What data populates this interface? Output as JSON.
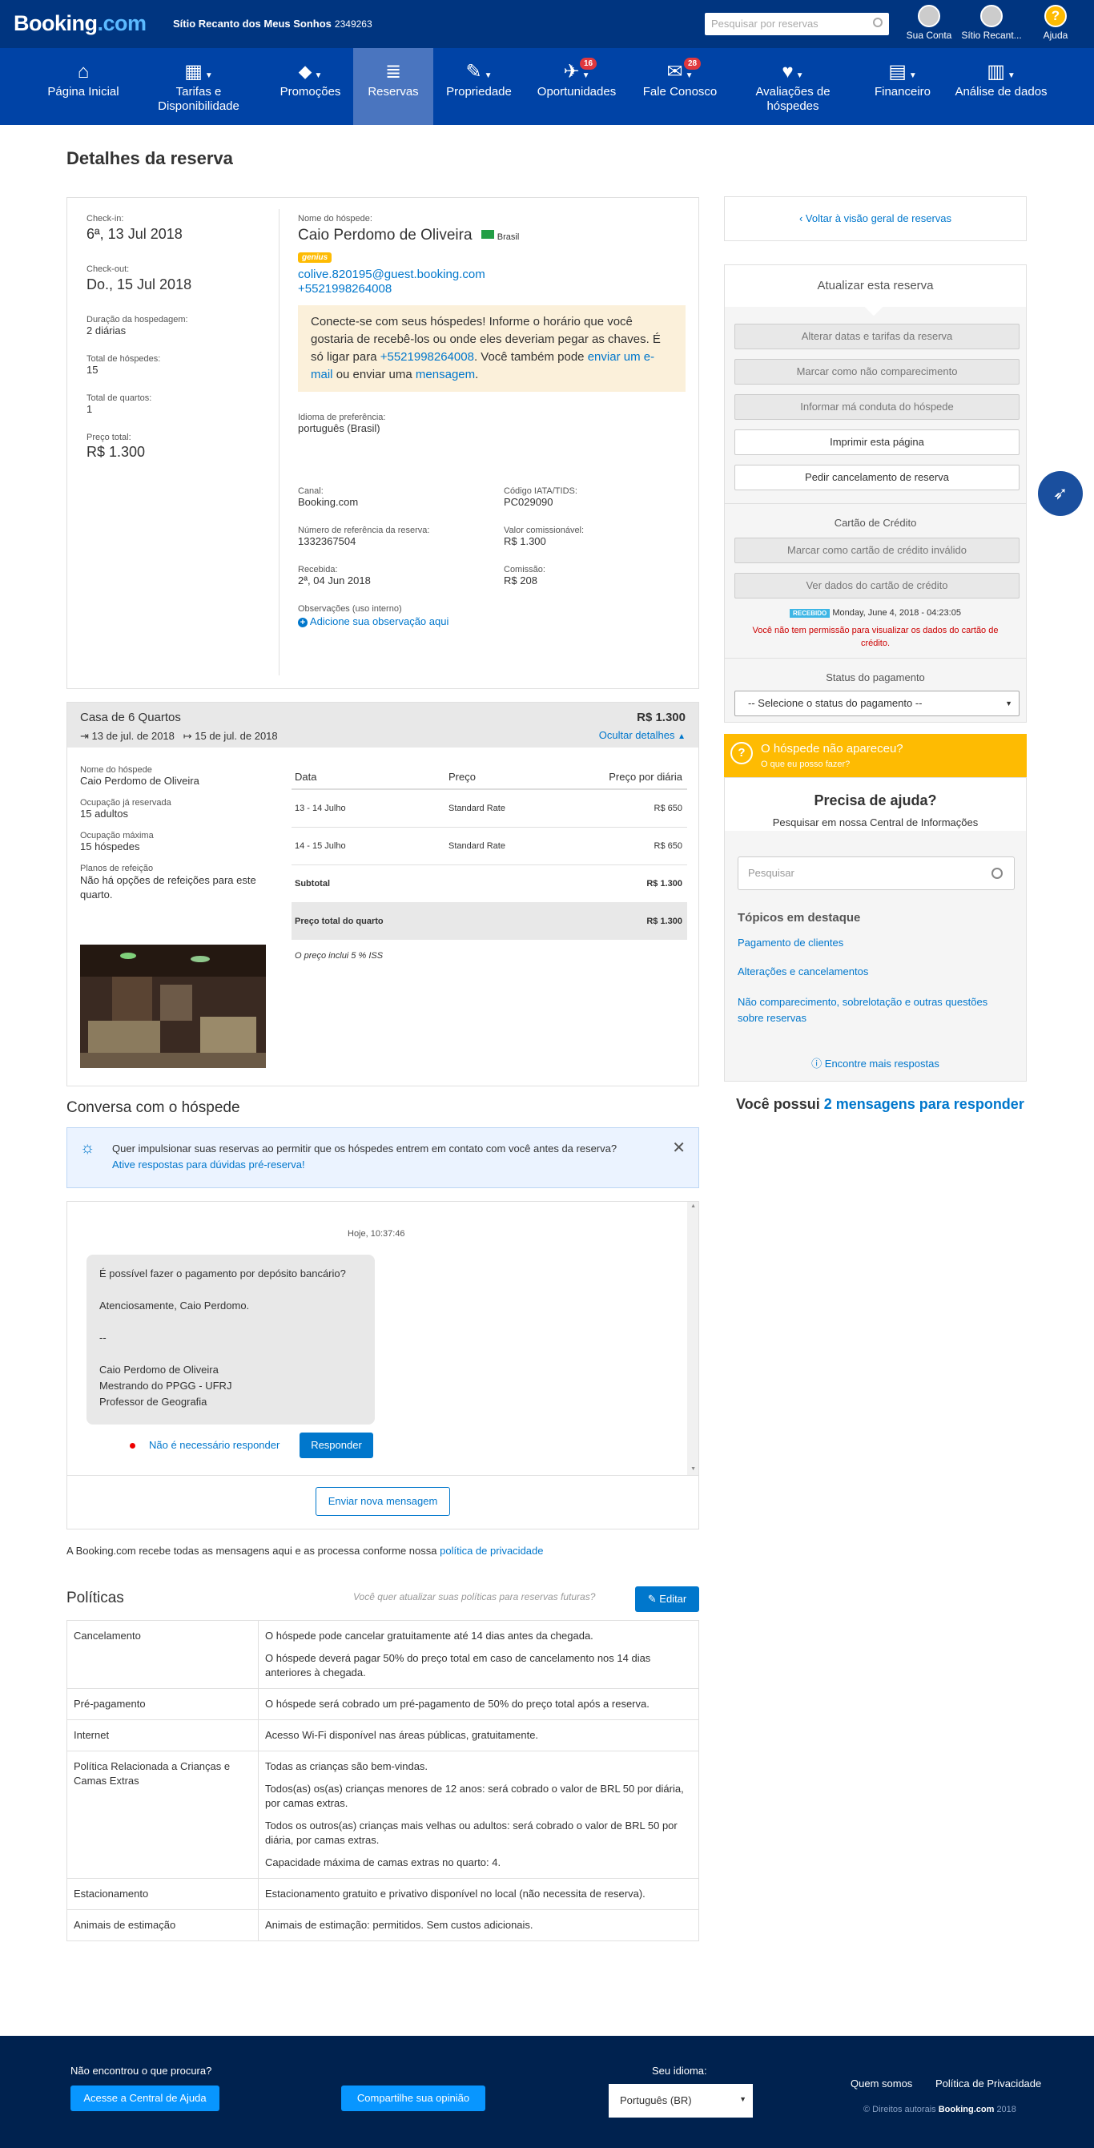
{
  "header": {
    "logo_a": "Booking",
    "logo_b": ".com",
    "property_name": "Sítio Recanto dos Meus Sonhos",
    "property_id": "2349263",
    "search_placeholder": "Pesquisar por reservas",
    "account_label": "Sua Conta",
    "property_menu_label": "Sítio Recant...",
    "help_label": "Ajuda",
    "help_glyph": "?"
  },
  "nav": [
    {
      "label": "Página Inicial",
      "icon": "⌂"
    },
    {
      "label": "Tarifas e Disponibilidade",
      "icon": "▦"
    },
    {
      "label": "Promoções",
      "icon": "⬥"
    },
    {
      "label": "Reservas",
      "icon": "≣"
    },
    {
      "label": "Propriedade",
      "icon": "✎"
    },
    {
      "label": "Oportunidades",
      "icon": "✈",
      "badge": "16"
    },
    {
      "label": "Fale Conosco",
      "icon": "✉",
      "badge": "28"
    },
    {
      "label": "Avaliações de hóspedes",
      "icon": "♥"
    },
    {
      "label": "Financeiro",
      "icon": "▤"
    },
    {
      "label": "Análise de dados",
      "icon": "▥"
    }
  ],
  "page_title": "Detalhes da reserva",
  "reservation": {
    "checkin_label": "Check-in:",
    "checkin": "6ª, 13 Jul 2018",
    "checkout_label": "Check-out:",
    "checkout": "Do., 15 Jul 2018",
    "duration_label": "Duração da hospedagem:",
    "duration": "2 diárias",
    "guests_label": "Total de hóspedes:",
    "guests": "15",
    "rooms_label": "Total de quartos:",
    "rooms": "1",
    "price_label": "Preço total:",
    "price": "R$ 1.300",
    "guest_name_label": "Nome do hóspede:",
    "guest_name": "Caio Perdomo de Oliveira",
    "country": "Brasil",
    "genius": "genius",
    "email": "colive.820195@guest.booking.com",
    "phone": "+5521998264008",
    "contact_text_1": "Conecte-se com seus hóspedes! Informe o horário que você gostaria de recebê-los ou onde eles deveriam pegar as chaves. É só ligar para",
    "contact_phone": "+5521998264008",
    "contact_text_2": ". Você também pode",
    "contact_email_link": "enviar um e-mail",
    "contact_text_3": "ou enviar uma",
    "contact_msg_link": "mensagem",
    "contact_text_4": ".",
    "lang_label": "Idioma de preferência:",
    "lang": "português (Brasil)",
    "channel_label": "Canal:",
    "channel": "Booking.com",
    "iata_label": "Código IATA/TIDS:",
    "iata": "PC029090",
    "ref_label": "Número de referência da reserva:",
    "ref": "1332367504",
    "commissionable_label": "Valor comissionável:",
    "commissionable": "R$ 1.300",
    "received_label": "Recebida:",
    "received": "2ª, 04 Jun 2018",
    "commission_label": "Comissão:",
    "commission": "R$ 208",
    "notes_label": "Observações (uso interno)",
    "notes_link": "Adicione sua observação aqui"
  },
  "room": {
    "title": "Casa de 6 Quartos",
    "price": "R$ 1.300",
    "checkin": "13 de jul. de 2018",
    "checkout": "15 de jul. de 2018",
    "hide_details": "Ocultar detalhes",
    "guest_name_label": "Nome do hóspede",
    "guest_name": "Caio Perdomo de Oliveira",
    "occupancy_label": "Ocupação já reservada",
    "occupancy": "15 adultos",
    "max_occ_label": "Ocupação máxima",
    "max_occ": "15 hóspedes",
    "meal_label": "Planos de refeição",
    "meal": "Não há opções de refeições para este quarto.",
    "table_headers": [
      "Data",
      "Preço",
      "Preço por diária"
    ],
    "rows": [
      {
        "date": "13 - 14 Julho",
        "rate": "Standard Rate",
        "price": "R$ 650"
      },
      {
        "date": "14 - 15 Julho",
        "rate": "Standard Rate",
        "price": "R$ 650"
      }
    ],
    "subtotal_label": "Subtotal",
    "subtotal": "R$ 1.300",
    "total_label": "Preço total do quarto",
    "total": "R$ 1.300",
    "iss_note": "O preço inclui 5 % ISS"
  },
  "conversation": {
    "title": "Conversa com o hóspede",
    "tip_text": "Quer impulsionar suas reservas ao permitir que os hóspedes entrem em contato com você antes da reserva?",
    "tip_link": "Ative respostas para dúvidas pré-reserva!",
    "timestamp": "Hoje, 10:37:46",
    "message_lines": [
      "É possível fazer o pagamento por depósito bancário?",
      "",
      "Atenciosamente, Caio Perdomo.",
      "",
      "--",
      "",
      "Caio Perdomo de Oliveira",
      "Mestrando do PPGG - UFRJ",
      "Professor de Geografia"
    ],
    "no_reply": "Não é necessário responder",
    "reply": "Responder",
    "new_message": "Enviar nova mensagem",
    "privacy_text": "A Booking.com recebe todas as mensagens aqui e as processa conforme nossa",
    "privacy_link": "política de privacidade"
  },
  "policies": {
    "title": "Políticas",
    "update_hint": "Você quer atualizar suas políticas para reservas futuras?",
    "edit": "Editar",
    "rows": [
      {
        "name": "Cancelamento",
        "text": [
          "O hóspede pode cancelar gratuitamente até 14 dias antes da chegada.",
          "O hóspede deverá pagar 50% do preço total em caso de cancelamento nos 14 dias anteriores à chegada."
        ]
      },
      {
        "name": "Pré-pagamento",
        "text": [
          "O hóspede será cobrado um pré-pagamento de 50% do preço total após a reserva."
        ]
      },
      {
        "name": "Internet",
        "text": [
          "Acesso Wi-Fi disponível nas áreas públicas, gratuitamente."
        ]
      },
      {
        "name": "Política Relacionada a Crianças e Camas Extras",
        "text": [
          "Todas as crianças são bem-vindas.",
          "Todos(as) os(as) crianças menores de 12 anos: será cobrado o valor de BRL 50 por diária, por camas extras.",
          "Todos os outros(as) crianças mais velhas ou adultos: será cobrado o valor de BRL 50 por diária, por camas extras.",
          "Capacidade máxima de camas extras no quarto: 4."
        ]
      },
      {
        "name": "Estacionamento",
        "text": [
          "Estacionamento gratuito e privativo disponível no local (não necessita de reserva)."
        ]
      },
      {
        "name": "Animais de estimação",
        "text": [
          "Animais de estimação: permitidos. Sem custos adicionais."
        ]
      }
    ]
  },
  "sidebar": {
    "back_link": "Voltar à visão geral de reservas",
    "update_title": "Atualizar esta reserva",
    "buttons": [
      "Alterar datas e tarifas da reserva",
      "Marcar como não comparecimento",
      "Informar má conduta do hóspede",
      "Imprimir esta página",
      "Pedir cancelamento de reserva"
    ],
    "card_title": "Cartão de Crédito",
    "card_buttons": [
      "Marcar como cartão de crédito inválido",
      "Ver dados do cartão de crédito"
    ],
    "received_badge": "RECEBIDO",
    "received_date": "Monday, June 4, 2018 - 04:23:05",
    "card_warning": "Você não tem permissão para visualizar os dados do cartão de crédito.",
    "payment_title": "Status do pagamento",
    "payment_select": "-- Selecione o status do pagamento --",
    "noshow_title": "O hóspede não apareceu?",
    "noshow_link": "O que eu posso fazer?",
    "help_title": "Precisa de ajuda?",
    "help_sub": "Pesquisar em nossa Central de Informações",
    "help_search": "Pesquisar",
    "topics_title": "Tópicos em destaque",
    "topics": [
      "Pagamento de clientes",
      "Alterações e cancelamentos",
      "Não comparecimento, sobrelotação e outras questões sobre reservas"
    ],
    "more_answers": "Encontre mais respostas",
    "messages_prefix": "Você possui",
    "messages_link": "2 mensagens para responder"
  },
  "footer": {
    "not_found": "Não encontrou o que procura?",
    "help_center": "Acesse a Central de Ajuda",
    "share": "Compartilhe sua opinião",
    "lang_label": "Seu idioma:",
    "lang_value": "Português (BR)",
    "about": "Quem somos",
    "privacy": "Política de Privacidade",
    "copyright_a": "© Direitos autorais",
    "copyright_brand": "Booking.com",
    "copyright_year": "2018"
  },
  "colors": {
    "header": "#003580",
    "nav": "#0043a6",
    "accent": "#0077cc",
    "yellow": "#febb02"
  }
}
